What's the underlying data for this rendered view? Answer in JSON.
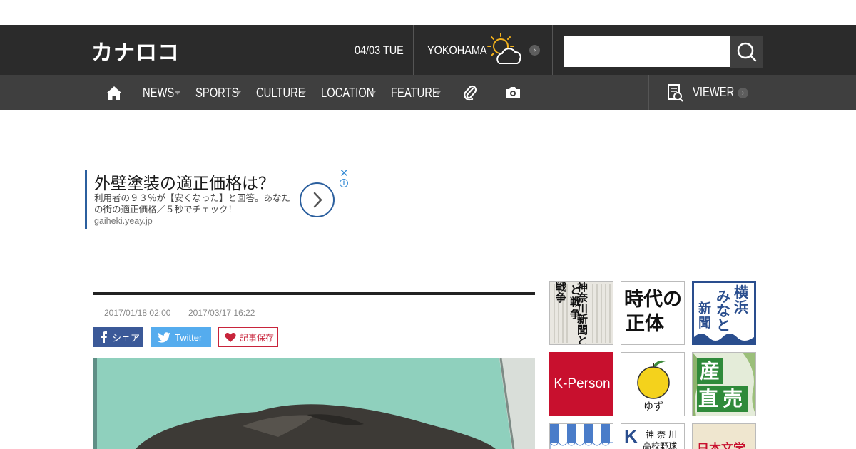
{
  "header": {
    "logo": "カナロコ",
    "date": "04/03 TUE",
    "city": "YOKOHAMA",
    "weather_icon": "sun-cloud-icon",
    "search": {
      "placeholder": "",
      "value": ""
    }
  },
  "nav": {
    "items": [
      {
        "label": "NEWS"
      },
      {
        "label": "SPORTS"
      },
      {
        "label": "CULTURE"
      },
      {
        "label": "LOCATION"
      },
      {
        "label": "FEATURE"
      }
    ],
    "viewer_label": "VIEWER"
  },
  "ad": {
    "title": "外壁塗装の適正価格は？",
    "body": "利用者の９３％が【安くなった】と回答。あなたの街の適正価格／５秒でチェック！",
    "domain": "gaiheki.yeay.jp",
    "close": "✕",
    "info": "i"
  },
  "article": {
    "published": "2017/01/18 02:00",
    "updated": "2017/03/17 16:22",
    "share_facebook": "シェア",
    "share_twitter": "Twitter",
    "save": "記事保存"
  },
  "sidebar": {
    "tiles": [
      {
        "name": "tile-kanagawa-shinbun-senso",
        "text": "神奈川新聞と戦争"
      },
      {
        "name": "tile-jidai-no-shotai",
        "line1": "時代の",
        "line2": "正体"
      },
      {
        "name": "tile-hama-minato-shinbun",
        "line1": "横浜",
        "line2": "みなと",
        "line3": "新聞"
      },
      {
        "name": "tile-k-person",
        "text": "K-Person"
      },
      {
        "name": "tile-yuzu",
        "text": "ゆず"
      },
      {
        "name": "tile-sanchi-chokubai",
        "line1": "産地",
        "line2": "直売"
      },
      {
        "name": "tile-awning",
        "text": ""
      },
      {
        "name": "tile-koko-yakyu",
        "line1": "神奈川",
        "line2": "高校野球"
      },
      {
        "name": "tile-nihon-bungaku",
        "text": "日本文学"
      }
    ]
  },
  "colors": {
    "header_bg": "#2b2b2b",
    "nav_bg": "#3f3f3f",
    "facebook": "#3b5998",
    "twitter": "#55acee",
    "save": "#c8243b",
    "k_person": "#c8102e",
    "ad_accent": "#2b5f9e"
  }
}
